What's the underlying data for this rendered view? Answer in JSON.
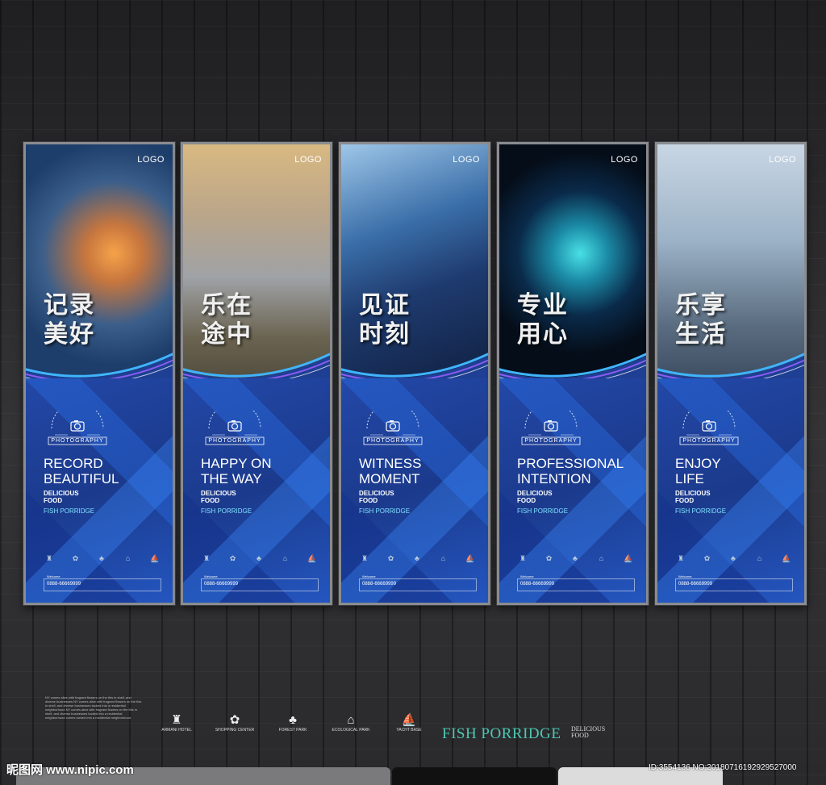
{
  "panels": [
    {
      "logo": "LOGO",
      "cn1": "记录",
      "cn2": "美好",
      "en1": "RECORD",
      "en2": "BEAUTIFUL",
      "sub1": "DELICIOUS",
      "sub2": "FOOD",
      "fish": "FISH PORRIDGE",
      "badge": "PHOTOGRAPHY",
      "phone": "0888-66669999",
      "contact_label": "Welcome"
    },
    {
      "logo": "LOGO",
      "cn1": "乐在",
      "cn2": "途中",
      "en1": "HAPPY ON",
      "en2": "THE WAY",
      "sub1": "DELICIOUS",
      "sub2": "FOOD",
      "fish": "FISH PORRIDGE",
      "badge": "PHOTOGRAPHY",
      "phone": "0888-66669999",
      "contact_label": "Welcome"
    },
    {
      "logo": "LOGO",
      "cn1": "见证",
      "cn2": "时刻",
      "en1": "WITNESS",
      "en2": "MOMENT",
      "sub1": "DELICIOUS",
      "sub2": "FOOD",
      "fish": "FISH PORRIDGE",
      "badge": "PHOTOGRAPHY",
      "phone": "0888-66669999",
      "contact_label": "Welcome"
    },
    {
      "logo": "LOGO",
      "cn1": "专业",
      "cn2": "用心",
      "en1": "PROFESSIONAL",
      "en2": "INTENTION",
      "sub1": "DELICIOUS",
      "sub2": "FOOD",
      "fish": "FISH PORRIDGE",
      "badge": "PHOTOGRAPHY",
      "phone": "0888-66669999",
      "contact_label": "Welcome"
    },
    {
      "logo": "LOGO",
      "cn1": "乐享",
      "cn2": "生活",
      "en1": "ENJOY",
      "en2": "LIFE",
      "sub1": "DELICIOUS",
      "sub2": "FOOD",
      "fish": "FISH PORRIDGE",
      "badge": "PHOTOGRAPHY",
      "phone": "0888-66669999",
      "contact_label": "Welcome"
    }
  ],
  "bottom_icons": [
    {
      "label": "ARMANI HOTEL",
      "icon": "hotel-icon",
      "glyph": "♜"
    },
    {
      "label": "SHOPPING CENTER",
      "icon": "flower-icon",
      "glyph": "✿"
    },
    {
      "label": "FOREST PARK",
      "icon": "tree-icon",
      "glyph": "♣"
    },
    {
      "label": "ECOLOGICAL PARK",
      "icon": "pavilion-icon",
      "glyph": "⌂"
    },
    {
      "label": "YACHT BASE",
      "icon": "yacht-icon",
      "glyph": "⛵"
    }
  ],
  "bottom_brand": {
    "fish": "FISH PORRIDGE",
    "delicious": "DELICIOUS",
    "food": "FOOD"
  },
  "legend_text": "NY comes alive with fragrant flowers on the this in shell, and diverse businesses NY comes alive with fragrant flowers on the this in shell, and diverse businesses tucked into a residential neighborhood NY comes alive with fragrant flowers on the this in shell, and diverse businesses tucked into a residential neighborhood comes tucked into a residential neighborhood",
  "watermark": {
    "site": "昵图网 www.nipic.com",
    "id": "ID:3554136 NO:20180716192929527000"
  }
}
